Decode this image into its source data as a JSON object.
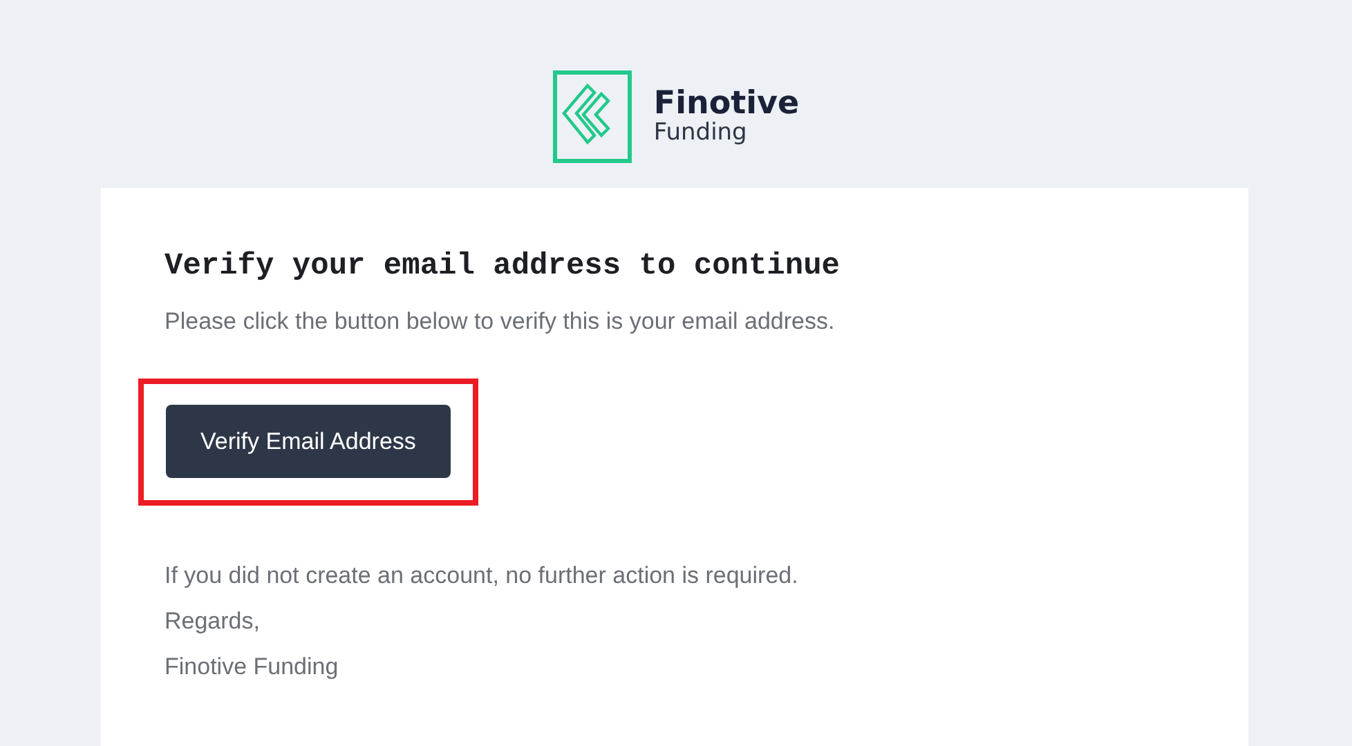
{
  "logo": {
    "name": "Finotive",
    "subtitle": "Funding"
  },
  "card": {
    "heading": "Verify your email address to continue",
    "intro": "Please click the button below to verify this is your email address.",
    "button": {
      "label": "Verify Email Address",
      "highlighted": true
    },
    "lines": [
      "If you did not create an account, no further action is required.",
      "Regards,",
      "Finotive Funding"
    ]
  }
}
